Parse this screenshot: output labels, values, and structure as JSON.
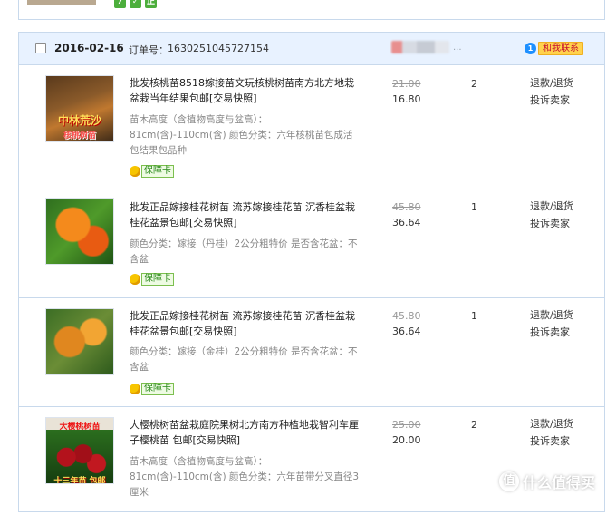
{
  "prev_order": {
    "icons": [
      {
        "name": "check-icon",
        "glyph": "7"
      },
      {
        "name": "shield-icon",
        "glyph": "✓"
      },
      {
        "name": "genuine-icon",
        "glyph": "正"
      }
    ]
  },
  "order": {
    "date": "2016-02-16",
    "order_no_label": "订单号：",
    "order_no": "1630251045727154",
    "seller_suffix": "...",
    "contact_label": "和我联系",
    "contact_icon_glyph": "1"
  },
  "items": [
    {
      "title": "批发核桃苗8518嫁接苗文玩核桃树苗南方北方地栽盆栽当年结果包邮[交易快照]",
      "props": "苗木高度（含植物高度与盆高）：81cm(含)-110cm(含) 颜色分类：六年核桃苗包成活包结果包品种",
      "badge": "保障卡",
      "price_orig": "21.00",
      "price_now": "16.80",
      "qty": "2",
      "actions": [
        "退款/退货",
        "投诉卖家"
      ],
      "thumb_text": [
        "中林荒沙",
        "核桃树苗"
      ]
    },
    {
      "title": "批发正品嫁接桂花树苗 流苏嫁接桂花苗 沉香桂盆栽桂花盆景包邮[交易快照]",
      "props": "颜色分类：嫁接（丹桂）2公分粗特价 是否含花盆：不含盆",
      "badge": "保障卡",
      "price_orig": "45.80",
      "price_now": "36.64",
      "qty": "1",
      "actions": [
        "退款/退货",
        "投诉卖家"
      ]
    },
    {
      "title": "批发正品嫁接桂花树苗 流苏嫁接桂花苗 沉香桂盆栽桂花盆景包邮[交易快照]",
      "props": "颜色分类：嫁接（金桂）2公分粗特价 是否含花盆：不含盆",
      "badge": "保障卡",
      "price_orig": "45.80",
      "price_now": "36.64",
      "qty": "1",
      "actions": [
        "退款/退货",
        "投诉卖家"
      ]
    },
    {
      "title": "大樱桃树苗盆栽庭院果树北方南方种植地栽智利车厘子樱桃苗 包邮[交易快照]",
      "props": "苗木高度（含植物高度与盆高）：81cm(含)-110cm(含) 颜色分类：六年苗带分叉直径3厘米",
      "badge": "保障卡",
      "price_orig": "25.00",
      "price_now": "20.00",
      "qty": "2",
      "actions": [
        "退款/退货",
        "投诉卖家"
      ],
      "thumb_text": [
        "大樱桃树苗",
        "十三年苗 包邮"
      ]
    }
  ],
  "watermark": {
    "icon_glyph": "值",
    "text": "什么值得买"
  }
}
